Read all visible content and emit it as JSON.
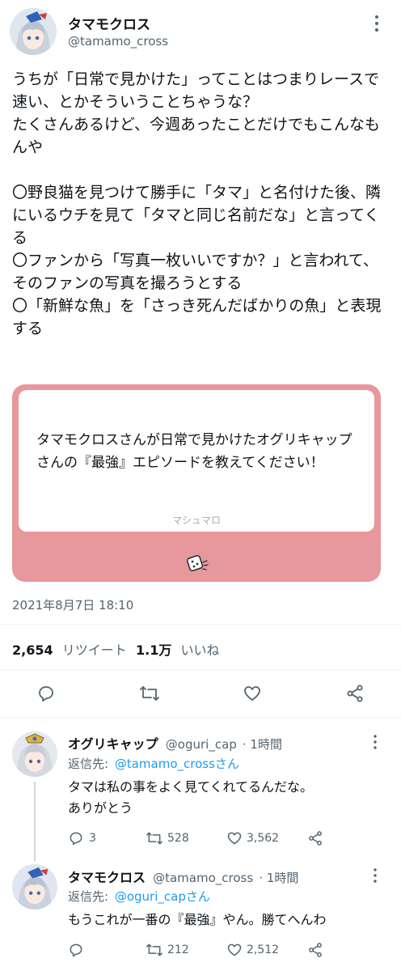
{
  "tweet": {
    "display_name": "タマモクロス",
    "handle": "@tamamo_cross",
    "text": "うちが「日常で見かけた」ってことはつまりレースで速い、とかそういうことちゃうな？\nたくさんあるけど、今週あったことだけでもこんなもんや\n\n〇野良猫を見つけて勝手に「タマ」と名付けた後、隣にいるウチを見て「タマと同じ名前だな」と言ってくる\n〇ファンから「写真一枚いいですか？」と言われて、そのファンの写真を撮ろうとする\n〇「新鮮な魚」を「さっき死んだばかりの魚」と表現する",
    "card": {
      "question": "タマモクロスさんが日常で見かけたオグリキャップさんの『最強』エピソードを教えてください！",
      "brand": "マシュマロ",
      "brand_color": "#e7989c"
    },
    "timestamp": "2021年8月7日 18:10",
    "retweets_count": "2,654",
    "retweets_label": "リツイート",
    "likes_count": "1.1万",
    "likes_label": "いいね",
    "actions": [
      "reply-icon",
      "retweet-icon",
      "like-icon",
      "share-icon"
    ]
  },
  "replies": [
    {
      "display_name": "オグリキャップ",
      "handle": "@oguri_cap",
      "time": "· 1時間",
      "reply_to_label": "返信先:",
      "reply_to_handle": "@tamamo_crossさん",
      "text": "タマは私の事をよく見てくれてるんだな。\nありがとう",
      "reply_count": "3",
      "retweet_count": "528",
      "like_count": "3,562"
    },
    {
      "display_name": "タマモクロス",
      "handle": "@tamamo_cross",
      "time": "· 1時間",
      "reply_to_label": "返信先:",
      "reply_to_handle": "@oguri_capさん",
      "text": "もうこれが一番の『最強』やん。勝てへんわ",
      "reply_count": "",
      "retweet_count": "212",
      "like_count": "2,512"
    }
  ],
  "colors": {
    "link": "#1d9bf0",
    "muted": "#536471",
    "text": "#0f1419"
  }
}
